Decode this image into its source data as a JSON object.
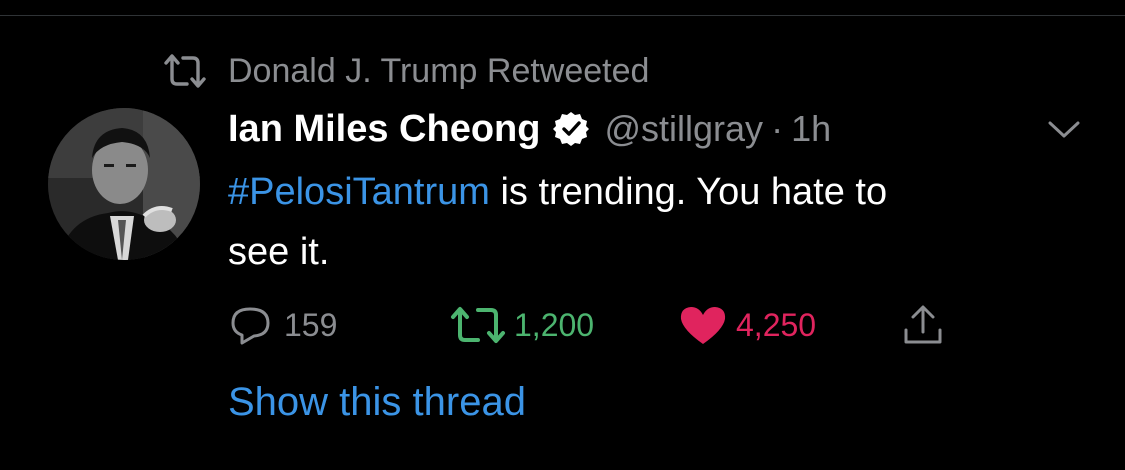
{
  "retweet_context": {
    "label": "Donald J. Trump Retweeted",
    "icon": "retweet-icon"
  },
  "tweet": {
    "author": {
      "display_name": "Ian Miles Cheong",
      "verified": true,
      "handle": "@stillgray",
      "avatar_icon": "avatar"
    },
    "separator": "·",
    "time": "1h",
    "text": {
      "hashtag": "#PelosiTantrum",
      "rest_line1": " is trending. You hate to",
      "rest_line2": "see it."
    },
    "actions": {
      "reply": {
        "icon": "reply-icon",
        "count": "159"
      },
      "retweet": {
        "icon": "retweet-icon",
        "count": "1,200"
      },
      "like": {
        "icon": "heart-icon",
        "count": "4,250"
      },
      "share": {
        "icon": "share-icon"
      }
    },
    "show_thread": "Show this thread"
  },
  "colors": {
    "background": "#000000",
    "text": "#ffffff",
    "muted": "#8b8d91",
    "link": "#3b94e6",
    "retweet": "#4cb46f",
    "like": "#e0245e"
  }
}
